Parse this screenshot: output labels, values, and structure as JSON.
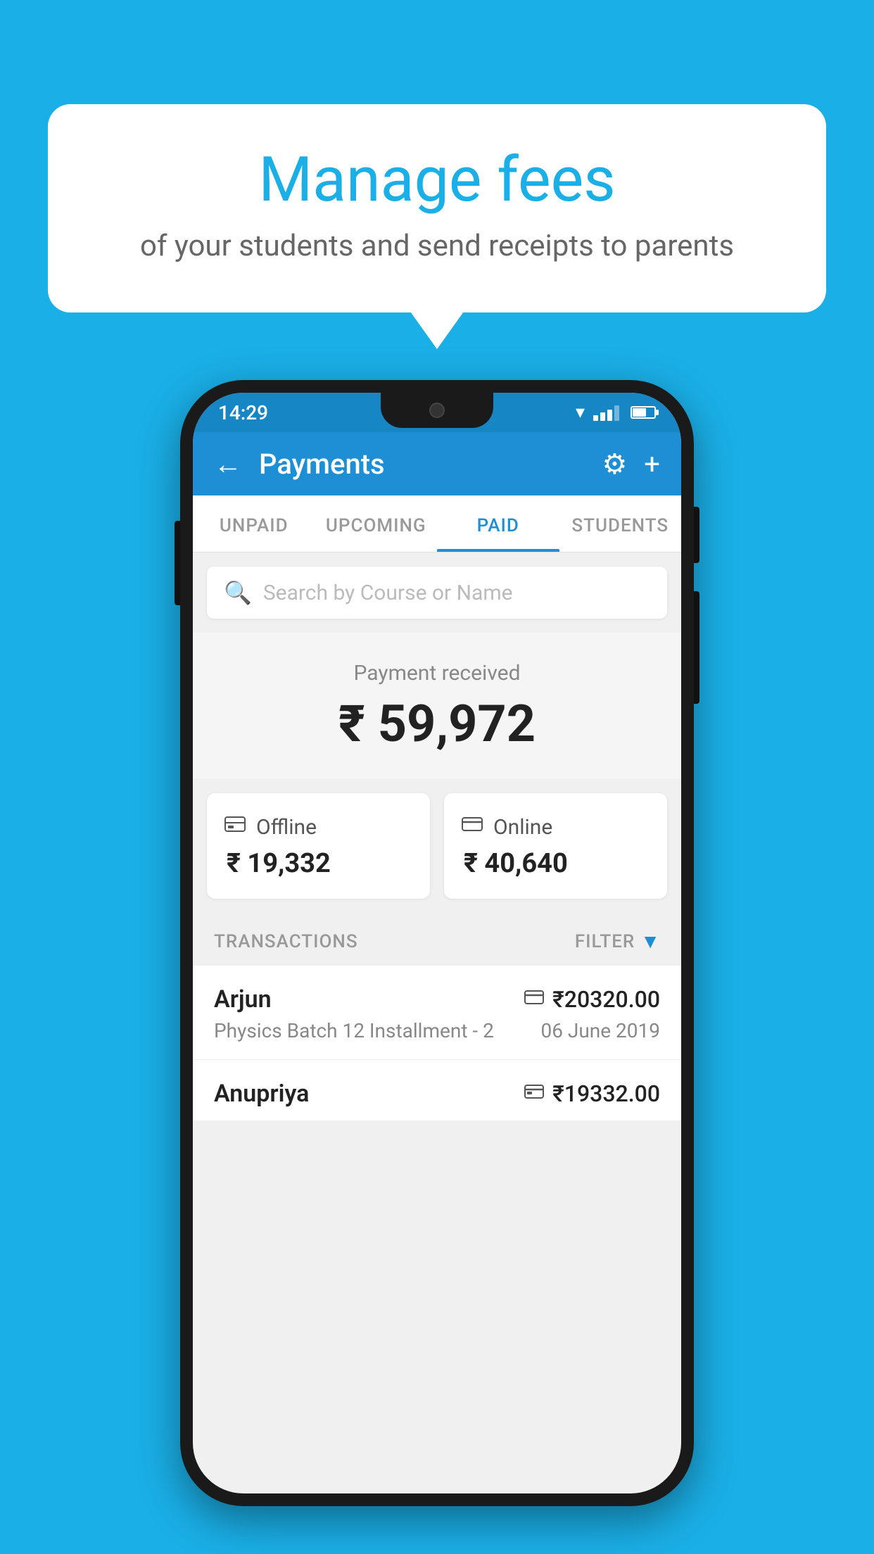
{
  "background": {
    "color": "#1AAFE6"
  },
  "speech_bubble": {
    "title": "Manage fees",
    "subtitle": "of your students and send receipts to parents"
  },
  "phone": {
    "status_bar": {
      "time": "14:29"
    },
    "header": {
      "title": "Payments",
      "back_label": "←",
      "settings_label": "⚙",
      "add_label": "+"
    },
    "tabs": [
      {
        "label": "UNPAID",
        "active": false
      },
      {
        "label": "UPCOMING",
        "active": false
      },
      {
        "label": "PAID",
        "active": true
      },
      {
        "label": "STUDENTS",
        "active": false
      }
    ],
    "search": {
      "placeholder": "Search by Course or Name"
    },
    "payment_received": {
      "label": "Payment received",
      "amount": "₹ 59,972"
    },
    "payment_cards": [
      {
        "label": "Offline",
        "amount": "₹ 19,332",
        "icon": "rupee-note-icon"
      },
      {
        "label": "Online",
        "amount": "₹ 40,640",
        "icon": "credit-card-icon"
      }
    ],
    "transactions_section": {
      "label": "TRANSACTIONS",
      "filter_label": "FILTER",
      "items": [
        {
          "name": "Arjun",
          "course": "Physics Batch 12 Installment - 2",
          "amount": "₹20320.00",
          "date": "06 June 2019",
          "payment_type": "online"
        },
        {
          "name": "Anupriya",
          "course": "",
          "amount": "₹19332.00",
          "date": "",
          "payment_type": "offline"
        }
      ]
    }
  }
}
